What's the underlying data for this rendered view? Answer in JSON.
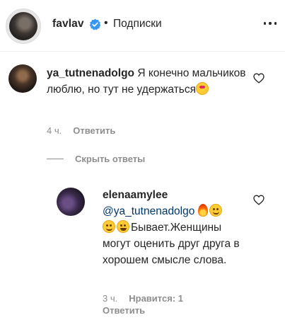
{
  "header": {
    "username": "favlav",
    "separator": "•",
    "follow_status": "Подписки"
  },
  "comments": [
    {
      "username": "ya_tutnenadolgo",
      "text": "Я конечно мальчиков люблю, но тут не удержаться",
      "emoji": [
        "heart-eyes-emoji"
      ],
      "time": "4 ч.",
      "reply_label": "Ответить"
    }
  ],
  "toggle_replies_label": "Скрыть ответы",
  "replies": [
    {
      "username": "elenaamylee",
      "mention": "@ya_tutnenadolgo",
      "emoji_after_mention": [
        "fire-emoji",
        "smiling-face-emoji",
        "smiling-face-emoji",
        "laughing-emoji"
      ],
      "text": "Бывает.Женщины могут оценить друг друга в хорошем смысле слова.",
      "time": "3 ч.",
      "likes": "Нравится: 1",
      "reply_label": "Ответить"
    }
  ],
  "colors": {
    "text": "#262626",
    "secondary": "#8e8e8e",
    "mention": "#00376b",
    "verified": "#3897f0"
  }
}
